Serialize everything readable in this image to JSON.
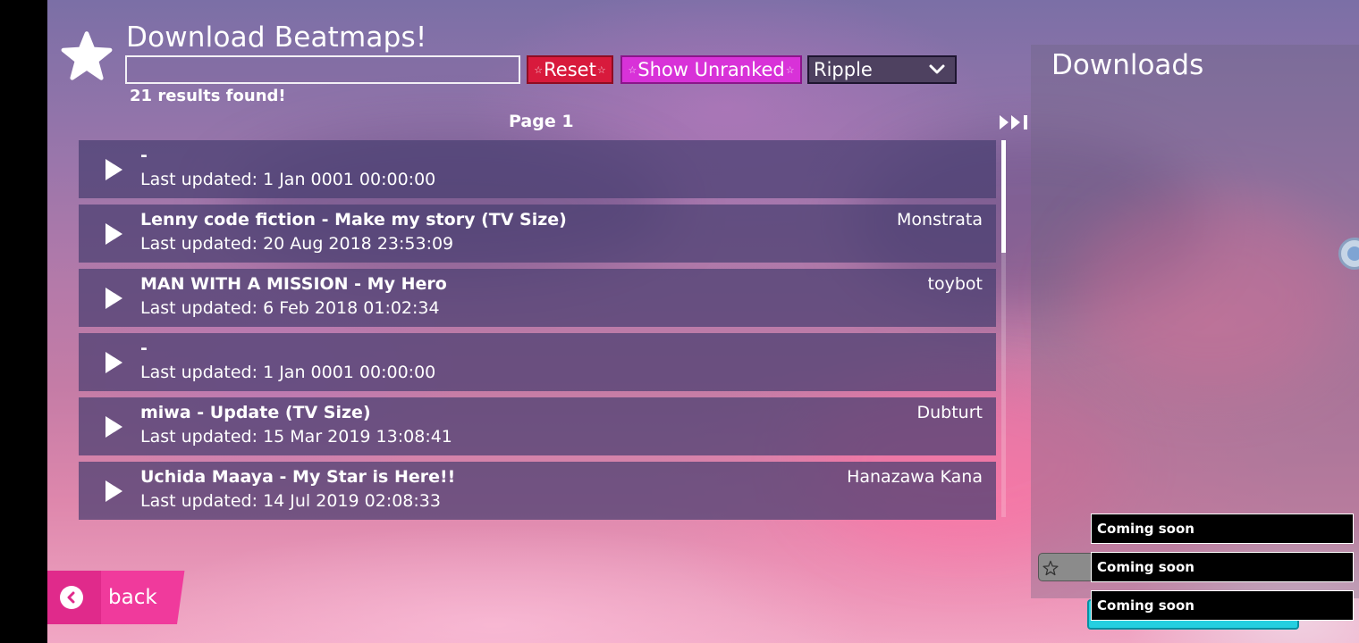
{
  "header": {
    "title": "Download Beatmaps!",
    "search": {
      "value": "",
      "placeholder": ""
    },
    "reset_label": "Reset",
    "show_unranked_label": "Show Unranked",
    "server_select": {
      "selected": "Ripple"
    },
    "results_text": "21 results found!",
    "page_label": "Page 1"
  },
  "beatmaps": [
    {
      "title": "-",
      "last_updated": "Last updated: 1 Jan 0001 00:00:00",
      "mapper": ""
    },
    {
      "title": "Lenny code fiction - Make my story (TV Size)",
      "last_updated": "Last updated: 20 Aug 2018 23:53:09",
      "mapper": "Monstrata"
    },
    {
      "title": "MAN WITH A MISSION - My Hero",
      "last_updated": "Last updated: 6 Feb 2018 01:02:34",
      "mapper": "toybot"
    },
    {
      "title": "-",
      "last_updated": "Last updated: 1 Jan 0001 00:00:00",
      "mapper": ""
    },
    {
      "title": "miwa - Update (TV Size)",
      "last_updated": "Last updated: 15 Mar 2019 13:08:41",
      "mapper": "Dubturt"
    },
    {
      "title": "Uchida Maaya - My Star is Here!!",
      "last_updated": "Last updated: 14 Jul 2019 02:08:33",
      "mapper": "Hanazawa Kana"
    }
  ],
  "downloads": {
    "title": "Downloads"
  },
  "toasts": [
    "Coming soon",
    "Coming soon",
    "Coming soon"
  ],
  "back_label": "back",
  "colors": {
    "reset": "#d81a3c",
    "show_unranked": "#d832d8",
    "back": "#f03a9c",
    "row_bg": "#483e70"
  },
  "icons": {
    "logo": "star-icon",
    "play": "play-icon",
    "next_page": "skip-forward-icon",
    "select": "chevron-down-icon",
    "back": "chevron-left-icon",
    "favorite": "star-outline-icon"
  }
}
